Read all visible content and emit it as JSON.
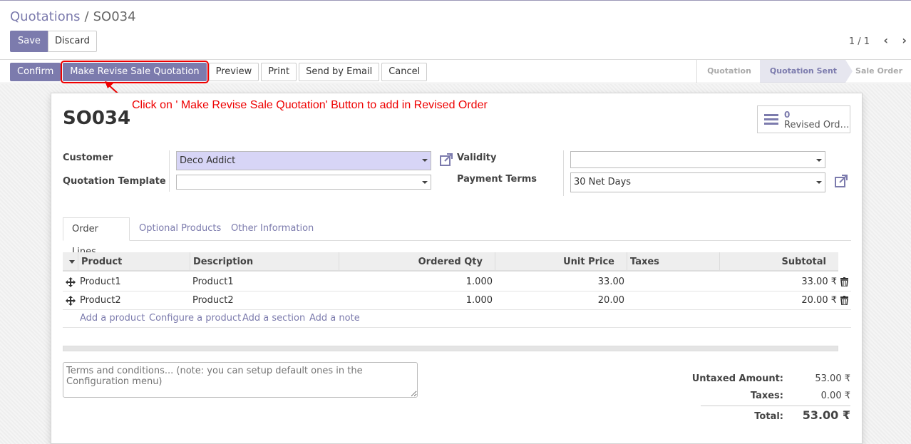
{
  "breadcrumb": {
    "parent": "Quotations",
    "separator": "/",
    "current": "SO034"
  },
  "control": {
    "save_label": "Save",
    "discard_label": "Discard",
    "pager": "1 / 1"
  },
  "actions": [
    {
      "label": "Confirm"
    },
    {
      "label": "Make Revise Sale Quotation"
    },
    {
      "label": "Preview"
    },
    {
      "label": "Print"
    },
    {
      "label": "Send by Email"
    },
    {
      "label": "Cancel"
    }
  ],
  "stages": [
    "Quotation",
    "Quotation Sent",
    "Sale Order"
  ],
  "annotation": "Click on ' Make Revise Sale Quotation' Button to add in Revised Order",
  "form": {
    "title": "SO034",
    "smart_button": {
      "count": "0",
      "label": "Revised Ord…"
    },
    "customer_label": "Customer",
    "customer_value": "Deco Addict",
    "template_label": "Quotation Template",
    "template_value": "",
    "validity_label": "Validity",
    "validity_value": "",
    "payment_terms_label": "Payment Terms",
    "payment_terms_value": "30 Net Days"
  },
  "tabs": [
    "Order Lines",
    "Optional Products",
    "Other Information"
  ],
  "table": {
    "headers": [
      "Product",
      "Description",
      "Ordered Qty",
      "Unit Price",
      "Taxes",
      "Subtotal"
    ],
    "rows": [
      {
        "product": "Product1",
        "description": "Product1",
        "qty": "1.000",
        "price": "33.00",
        "taxes": "",
        "subtotal": "33.00 ₹"
      },
      {
        "product": "Product2",
        "description": "Product2",
        "qty": "1.000",
        "price": "20.00",
        "taxes": "",
        "subtotal": "20.00 ₹"
      }
    ],
    "add_links": [
      "Add a product",
      "Configure a product",
      "Add a section",
      "Add a note"
    ]
  },
  "terms_placeholder": "Terms and conditions... (note: you can setup default ones in the Configuration menu)",
  "totals": {
    "untaxed_label": "Untaxed Amount:",
    "untaxed_value": "53.00 ₹",
    "taxes_label": "Taxes:",
    "taxes_value": "0.00 ₹",
    "total_label": "Total:",
    "total_value": "53.00 ₹"
  },
  "colors": {
    "accent": "#7c7bad",
    "annotation": "#e00000"
  }
}
